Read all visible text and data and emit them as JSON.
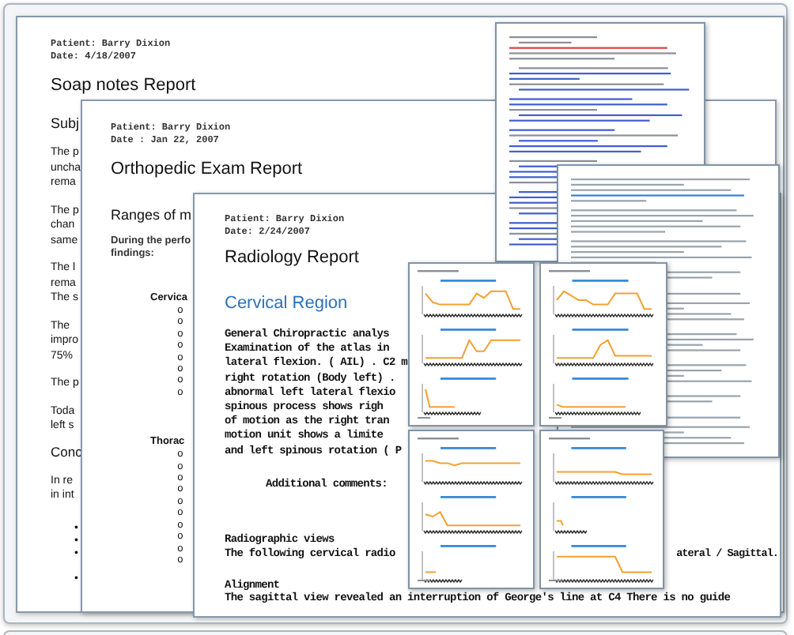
{
  "soap_report": {
    "patient": "Patient: Barry Dixion",
    "date": "Date: 4/18/2007",
    "title": "Soap notes Report",
    "section_heading": "Subj",
    "paragraphs": [
      [
        "The p",
        "uncha",
        "rema"
      ],
      [
        "The p",
        "chan",
        "same"
      ],
      [
        "The l",
        "rema",
        "The s"
      ],
      [
        "The",
        "impro",
        "75%"
      ],
      [
        "The p"
      ],
      [
        "Toda",
        "left s"
      ]
    ],
    "conclusion_heading": "Conc",
    "conclusion_paragraph": [
      "In re",
      "in int"
    ],
    "bullets": [
      "•",
      "•",
      "•",
      "•"
    ]
  },
  "orthopedic_report": {
    "patient": "Patient: Barry Dixion",
    "date": "Date : Jan 22, 2007",
    "title": "Orthopedic Exam Report",
    "ranges_heading": "Ranges of m",
    "intro": [
      "During the perfo",
      "findings:"
    ],
    "groups": [
      {
        "label": "Cervica",
        "items": [
          "o",
          "o",
          "o",
          "o",
          "o",
          "o",
          "o",
          "o"
        ]
      },
      {
        "label": "Thorac",
        "items": [
          "o",
          "o",
          "o",
          "o",
          "o",
          "o",
          "o",
          "o",
          "o",
          "o"
        ]
      }
    ]
  },
  "radiology_report": {
    "patient": "Patient: Barry Dixion",
    "date": "Date: 2/24/2007",
    "title": "Radiology Report",
    "region_heading": "Cervical Region",
    "analysis_lines": [
      "General Chiropractic analys",
      "Examination of the atlas in",
      "lateral flexion. ( AIL) . C2 m",
      "right rotation (Body left) .",
      "abnormal left lateral flexio",
      "spinous process shows righ",
      "of motion as the right tran",
      "motion unit shows a limite",
      "and left spinous rotation ( P"
    ],
    "comments_label": "Additional comments:",
    "views_heading": "Radiographic views",
    "views_line": "The following cervical radio",
    "views_line_end": "ateral / Sagittal.",
    "alignment_heading": "Alignment",
    "alignment_line": "The sagittal view revealed an interruption of George's line at C4 There is no guide"
  },
  "thumbnail_pages": [
    {
      "kind": "text"
    },
    {
      "kind": "text"
    },
    {
      "kind": "chart"
    },
    {
      "kind": "chart"
    },
    {
      "kind": "chart"
    },
    {
      "kind": "chart"
    }
  ]
}
